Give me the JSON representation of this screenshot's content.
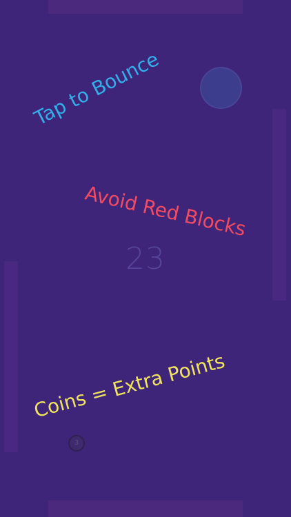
{
  "game": {
    "score": "23",
    "hints": {
      "tap": "Tap to Bounce",
      "avoid": "Avoid Red Blocks",
      "coins": "Coins = Extra Points"
    },
    "coin": {
      "value": "3"
    },
    "colors": {
      "background": "#3f2579",
      "paddle": "#4b2982",
      "ball": "#3c3d8d",
      "tap_text": "#34aee8",
      "avoid_text": "#f04b62",
      "coins_text": "#efe45d",
      "score_text": "#55449a"
    }
  }
}
